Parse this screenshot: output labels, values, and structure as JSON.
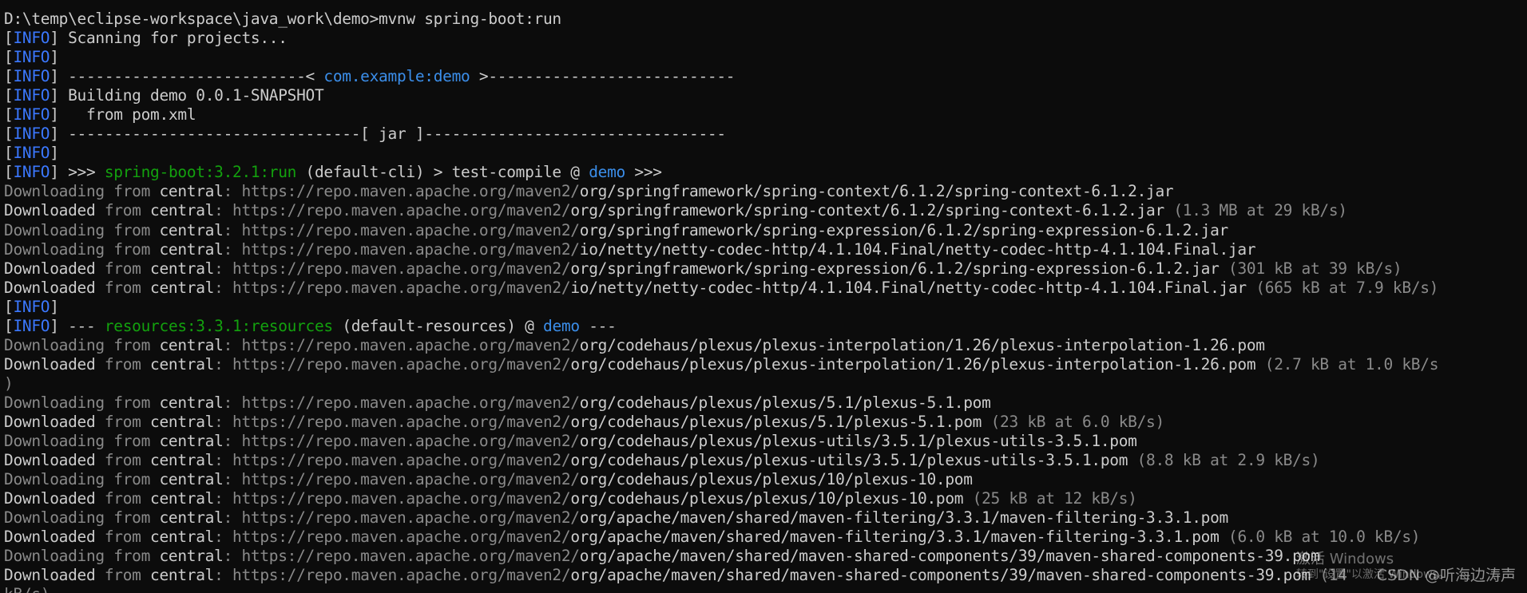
{
  "console": {
    "lines": [
      [
        {
          "t": "D:\\temp\\eclipse-workspace\\java_work\\demo>mvnw spring-boot:run",
          "c": "text"
        }
      ],
      [
        {
          "t": "[",
          "c": "text"
        },
        {
          "t": "INFO",
          "c": "info"
        },
        {
          "t": "] Scanning for projects...",
          "c": "text"
        }
      ],
      [
        {
          "t": "[",
          "c": "text"
        },
        {
          "t": "INFO",
          "c": "info"
        },
        {
          "t": "]",
          "c": "text"
        }
      ],
      [
        {
          "t": "[",
          "c": "text"
        },
        {
          "t": "INFO",
          "c": "info"
        },
        {
          "t": "] --------------------------< ",
          "c": "text"
        },
        {
          "t": "com.example:demo",
          "c": "link"
        },
        {
          "t": " >---------------------------",
          "c": "text"
        }
      ],
      [
        {
          "t": "[",
          "c": "text"
        },
        {
          "t": "INFO",
          "c": "info"
        },
        {
          "t": "] Building demo 0.0.1-SNAPSHOT",
          "c": "text"
        }
      ],
      [
        {
          "t": "[",
          "c": "text"
        },
        {
          "t": "INFO",
          "c": "info"
        },
        {
          "t": "]   from pom.xml",
          "c": "text"
        }
      ],
      [
        {
          "t": "[",
          "c": "text"
        },
        {
          "t": "INFO",
          "c": "info"
        },
        {
          "t": "] --------------------------------[ jar ]---------------------------------",
          "c": "text"
        }
      ],
      [
        {
          "t": "[",
          "c": "text"
        },
        {
          "t": "INFO",
          "c": "info"
        },
        {
          "t": "]",
          "c": "text"
        }
      ],
      [
        {
          "t": "[",
          "c": "text"
        },
        {
          "t": "INFO",
          "c": "info"
        },
        {
          "t": "] >>> ",
          "c": "text"
        },
        {
          "t": "spring-boot:3.2.1:run",
          "c": "green"
        },
        {
          "t": " (default-cli) > test-compile @ ",
          "c": "text"
        },
        {
          "t": "demo",
          "c": "link"
        },
        {
          "t": " >>>",
          "c": "text"
        }
      ],
      [
        {
          "t": "Downloading from ",
          "c": "dim"
        },
        {
          "t": "central",
          "c": "text"
        },
        {
          "t": ": https://repo.maven.apache.org/maven2/",
          "c": "dim"
        },
        {
          "t": "org/springframework/spring-context/6.1.2/spring-context-6.1.2.jar",
          "c": "text"
        }
      ],
      [
        {
          "t": "Downloaded ",
          "c": "text"
        },
        {
          "t": "from ",
          "c": "dim"
        },
        {
          "t": "central",
          "c": "text"
        },
        {
          "t": ": https://repo.maven.apache.org/maven2/",
          "c": "dim"
        },
        {
          "t": "org/springframework/spring-context/6.1.2/spring-context-6.1.2.jar",
          "c": "text"
        },
        {
          "t": " (1.3 MB at 29 kB/s)",
          "c": "dim"
        }
      ],
      [
        {
          "t": "Downloading from ",
          "c": "dim"
        },
        {
          "t": "central",
          "c": "text"
        },
        {
          "t": ": https://repo.maven.apache.org/maven2/",
          "c": "dim"
        },
        {
          "t": "org/springframework/spring-expression/6.1.2/spring-expression-6.1.2.jar",
          "c": "text"
        }
      ],
      [
        {
          "t": "Downloading from ",
          "c": "dim"
        },
        {
          "t": "central",
          "c": "text"
        },
        {
          "t": ": https://repo.maven.apache.org/maven2/",
          "c": "dim"
        },
        {
          "t": "io/netty/netty-codec-http/4.1.104.Final/netty-codec-http-4.1.104.Final.jar",
          "c": "text"
        }
      ],
      [
        {
          "t": "Downloaded ",
          "c": "text"
        },
        {
          "t": "from ",
          "c": "dim"
        },
        {
          "t": "central",
          "c": "text"
        },
        {
          "t": ": https://repo.maven.apache.org/maven2/",
          "c": "dim"
        },
        {
          "t": "org/springframework/spring-expression/6.1.2/spring-expression-6.1.2.jar",
          "c": "text"
        },
        {
          "t": " (301 kB at 39 kB/s)",
          "c": "dim"
        }
      ],
      [
        {
          "t": "Downloaded ",
          "c": "text"
        },
        {
          "t": "from ",
          "c": "dim"
        },
        {
          "t": "central",
          "c": "text"
        },
        {
          "t": ": https://repo.maven.apache.org/maven2/",
          "c": "dim"
        },
        {
          "t": "io/netty/netty-codec-http/4.1.104.Final/netty-codec-http-4.1.104.Final.jar",
          "c": "text"
        },
        {
          "t": " (665 kB at 7.9 kB/s)",
          "c": "dim"
        }
      ],
      [
        {
          "t": "[",
          "c": "text"
        },
        {
          "t": "INFO",
          "c": "info"
        },
        {
          "t": "]",
          "c": "text"
        }
      ],
      [
        {
          "t": "[",
          "c": "text"
        },
        {
          "t": "INFO",
          "c": "info"
        },
        {
          "t": "] --- ",
          "c": "text"
        },
        {
          "t": "resources:3.3.1:resources",
          "c": "green"
        },
        {
          "t": " (default-resources) @ ",
          "c": "text"
        },
        {
          "t": "demo",
          "c": "link"
        },
        {
          "t": " ---",
          "c": "text"
        }
      ],
      [
        {
          "t": "Downloading from ",
          "c": "dim"
        },
        {
          "t": "central",
          "c": "text"
        },
        {
          "t": ": https://repo.maven.apache.org/maven2/",
          "c": "dim"
        },
        {
          "t": "org/codehaus/plexus/plexus-interpolation/1.26/plexus-interpolation-1.26.pom",
          "c": "text"
        }
      ],
      [
        {
          "t": "Downloaded ",
          "c": "text"
        },
        {
          "t": "from ",
          "c": "dim"
        },
        {
          "t": "central",
          "c": "text"
        },
        {
          "t": ": https://repo.maven.apache.org/maven2/",
          "c": "dim"
        },
        {
          "t": "org/codehaus/plexus/plexus-interpolation/1.26/plexus-interpolation-1.26.pom",
          "c": "text"
        },
        {
          "t": " (2.7 kB at 1.0 kB/s",
          "c": "dim"
        }
      ],
      [
        {
          "t": ")",
          "c": "dim"
        }
      ],
      [
        {
          "t": "Downloading from ",
          "c": "dim"
        },
        {
          "t": "central",
          "c": "text"
        },
        {
          "t": ": https://repo.maven.apache.org/maven2/",
          "c": "dim"
        },
        {
          "t": "org/codehaus/plexus/plexus/5.1/plexus-5.1.pom",
          "c": "text"
        }
      ],
      [
        {
          "t": "Downloaded ",
          "c": "text"
        },
        {
          "t": "from ",
          "c": "dim"
        },
        {
          "t": "central",
          "c": "text"
        },
        {
          "t": ": https://repo.maven.apache.org/maven2/",
          "c": "dim"
        },
        {
          "t": "org/codehaus/plexus/plexus/5.1/plexus-5.1.pom",
          "c": "text"
        },
        {
          "t": " (23 kB at 6.0 kB/s)",
          "c": "dim"
        }
      ],
      [
        {
          "t": "Downloading from ",
          "c": "dim"
        },
        {
          "t": "central",
          "c": "text"
        },
        {
          "t": ": https://repo.maven.apache.org/maven2/",
          "c": "dim"
        },
        {
          "t": "org/codehaus/plexus/plexus-utils/3.5.1/plexus-utils-3.5.1.pom",
          "c": "text"
        }
      ],
      [
        {
          "t": "Downloaded ",
          "c": "text"
        },
        {
          "t": "from ",
          "c": "dim"
        },
        {
          "t": "central",
          "c": "text"
        },
        {
          "t": ": https://repo.maven.apache.org/maven2/",
          "c": "dim"
        },
        {
          "t": "org/codehaus/plexus/plexus-utils/3.5.1/plexus-utils-3.5.1.pom",
          "c": "text"
        },
        {
          "t": " (8.8 kB at 2.9 kB/s)",
          "c": "dim"
        }
      ],
      [
        {
          "t": "Downloading from ",
          "c": "dim"
        },
        {
          "t": "central",
          "c": "text"
        },
        {
          "t": ": https://repo.maven.apache.org/maven2/",
          "c": "dim"
        },
        {
          "t": "org/codehaus/plexus/plexus/10/plexus-10.pom",
          "c": "text"
        }
      ],
      [
        {
          "t": "Downloaded ",
          "c": "text"
        },
        {
          "t": "from ",
          "c": "dim"
        },
        {
          "t": "central",
          "c": "text"
        },
        {
          "t": ": https://repo.maven.apache.org/maven2/",
          "c": "dim"
        },
        {
          "t": "org/codehaus/plexus/plexus/10/plexus-10.pom",
          "c": "text"
        },
        {
          "t": " (25 kB at 12 kB/s)",
          "c": "dim"
        }
      ],
      [
        {
          "t": "Downloading from ",
          "c": "dim"
        },
        {
          "t": "central",
          "c": "text"
        },
        {
          "t": ": https://repo.maven.apache.org/maven2/",
          "c": "dim"
        },
        {
          "t": "org/apache/maven/shared/maven-filtering/3.3.1/maven-filtering-3.3.1.pom",
          "c": "text"
        }
      ],
      [
        {
          "t": "Downloaded ",
          "c": "text"
        },
        {
          "t": "from ",
          "c": "dim"
        },
        {
          "t": "central",
          "c": "text"
        },
        {
          "t": ": https://repo.maven.apache.org/maven2/",
          "c": "dim"
        },
        {
          "t": "org/apache/maven/shared/maven-filtering/3.3.1/maven-filtering-3.3.1.pom",
          "c": "text"
        },
        {
          "t": " (6.0 kB at 10.0 kB/s)",
          "c": "dim"
        }
      ],
      [
        {
          "t": "Downloading from ",
          "c": "dim"
        },
        {
          "t": "central",
          "c": "text"
        },
        {
          "t": ": https://repo.maven.apache.org/maven2/",
          "c": "dim"
        },
        {
          "t": "org/apache/maven/shared/maven-shared-components/39/maven-shared-components-39.pom",
          "c": "text"
        }
      ],
      [
        {
          "t": "Downloaded ",
          "c": "text"
        },
        {
          "t": "from ",
          "c": "dim"
        },
        {
          "t": "central",
          "c": "text"
        },
        {
          "t": ": https://repo.maven.apache.org/maven2/",
          "c": "dim"
        },
        {
          "t": "org/apache/maven/shared/maven-shared-components/39/maven-shared-components-39.pom",
          "c": "text"
        },
        {
          "t": " (14",
          "c": "dim"
        }
      ],
      [
        {
          "t": "kB/s)",
          "c": "dim"
        }
      ]
    ]
  },
  "overlay": {
    "activate_line1": "激活 Windows",
    "activate_line2": "转到\"设置\"以激活 Windows。",
    "csdn_watermark": "CSDN @听海边涛声"
  },
  "colors": {
    "background": "#0c0c0c",
    "text": "#cccccc",
    "dim": "#8a8a8a",
    "info_blue": "#3b78ff",
    "link_blue": "#3b8eea",
    "green": "#13a10e"
  }
}
